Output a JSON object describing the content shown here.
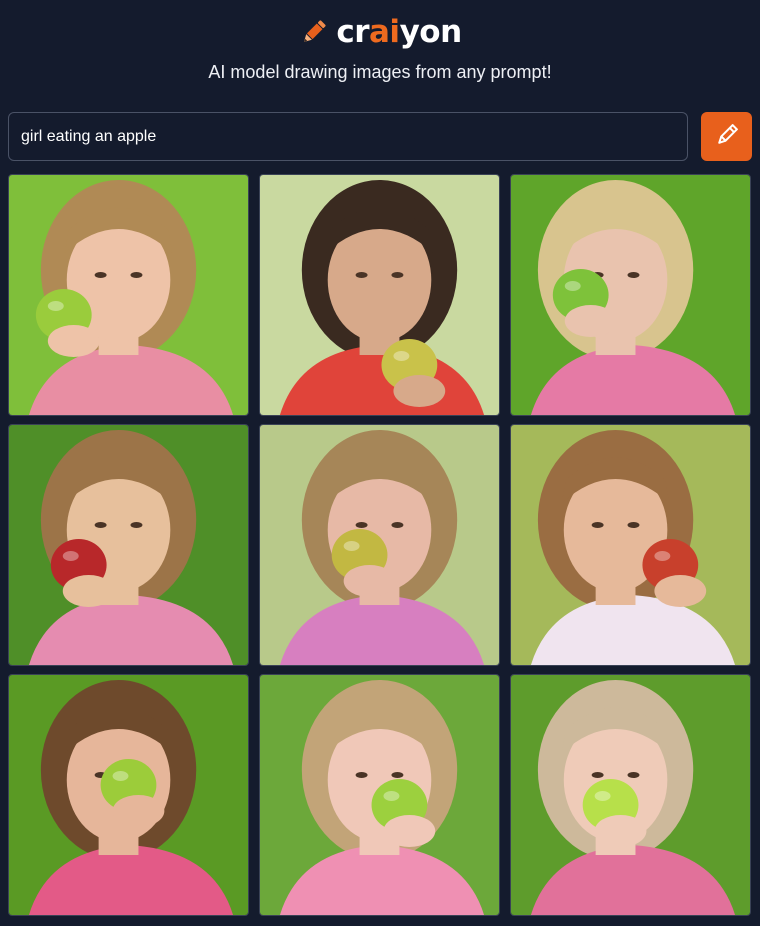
{
  "header": {
    "logo_prefix": "cr",
    "logo_accent": "ai",
    "logo_suffix": "yon",
    "logo_icon": "pencil-icon",
    "tagline": "AI model drawing images from any prompt!"
  },
  "prompt": {
    "value": "girl eating an apple"
  },
  "draw_button": {
    "icon": "pencil-icon"
  },
  "colors": {
    "background": "#141b2d",
    "accent": "#e8601c",
    "input_border": "#4a5266"
  },
  "results": [
    {
      "bg": "#7fbf3a",
      "hair": "#b08a55",
      "skin": "#eec3a8",
      "shirt": "#e88ea3",
      "apple": "#9acc3c"
    },
    {
      "bg": "#c9d9a0",
      "hair": "#3a2a20",
      "skin": "#d7a98a",
      "shirt": "#e0443a",
      "apple": "#c9c24a"
    },
    {
      "bg": "#5fa52a",
      "hair": "#d8c48e",
      "skin": "#e9c3ae",
      "shirt": "#e57aa5",
      "apple": "#7ec23a"
    },
    {
      "bg": "#4f8f28",
      "hair": "#9c7448",
      "skin": "#e7c09c",
      "shirt": "#e58cb0",
      "apple": "#b8282a"
    },
    {
      "bg": "#b8c98a",
      "hair": "#a68658",
      "skin": "#e7b9a6",
      "shirt": "#d77fc0",
      "apple": "#c2b842"
    },
    {
      "bg": "#a5b95a",
      "hair": "#9a6d42",
      "skin": "#e6b99a",
      "shirt": "#f0e4ef",
      "apple": "#c8402c"
    },
    {
      "bg": "#5a9a24",
      "hair": "#6e4a2c",
      "skin": "#e6b69a",
      "shirt": "#e35a87",
      "apple": "#9ccc3a"
    },
    {
      "bg": "#6ca83a",
      "hair": "#c2a478",
      "skin": "#f0c8b8",
      "shirt": "#ef90b3",
      "apple": "#9cd03e"
    },
    {
      "bg": "#5e9c2c",
      "hair": "#cdb99b",
      "skin": "#efcbb8",
      "shirt": "#e1719a",
      "apple": "#b7e04a"
    }
  ]
}
